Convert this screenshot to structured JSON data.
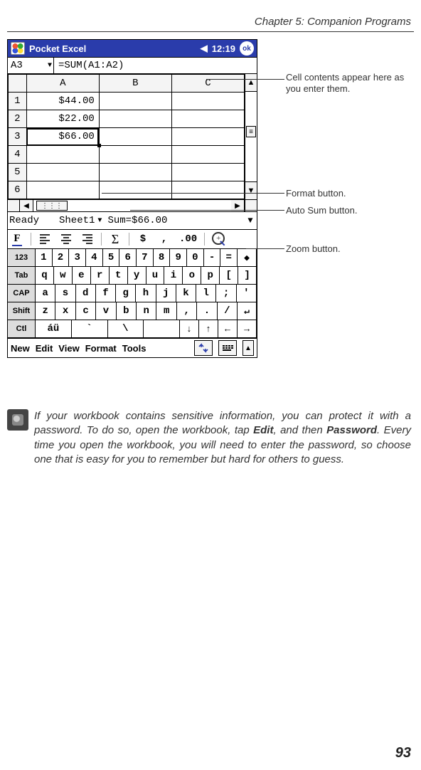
{
  "page": {
    "chapter_header": "Chapter 5: Companion Programs",
    "page_number": "93"
  },
  "callouts": {
    "formula": "Cell contents appear here as you enter them.",
    "format": "Format button.",
    "autosum": "Auto Sum button.",
    "zoom": "Zoom button."
  },
  "titlebar": {
    "app_name": "Pocket Excel",
    "time": "12:19",
    "ok_label": "ok"
  },
  "formula_bar": {
    "cell_ref": "A3",
    "formula": "=SUM(A1:A2)"
  },
  "columns": [
    "A",
    "B",
    "C"
  ],
  "rows": [
    {
      "num": "1",
      "A": "$44.00",
      "B": "",
      "C": "",
      "selected": false
    },
    {
      "num": "2",
      "A": "$22.00",
      "B": "",
      "C": "",
      "selected": false
    },
    {
      "num": "3",
      "A": "$66.00",
      "B": "",
      "C": "",
      "selected": true
    },
    {
      "num": "4",
      "A": "",
      "B": "",
      "C": "",
      "selected": false
    },
    {
      "num": "5",
      "A": "",
      "B": "",
      "C": "",
      "selected": false
    },
    {
      "num": "6",
      "A": "",
      "B": "",
      "C": "",
      "selected": false
    }
  ],
  "statusbar": {
    "ready": "Ready",
    "sheet": "Sheet1",
    "sum": "Sum=$66.00"
  },
  "toolbar": {
    "format_label": "F",
    "sigma": "Σ",
    "currency": "$",
    "thousands": ",",
    "decimals": ".00",
    "zoom_plus": "+"
  },
  "sip": {
    "row1": [
      "123",
      "1",
      "2",
      "3",
      "4",
      "5",
      "6",
      "7",
      "8",
      "9",
      "0",
      "-",
      "=",
      "◆"
    ],
    "row2": [
      "Tab",
      "q",
      "w",
      "e",
      "r",
      "t",
      "y",
      "u",
      "i",
      "o",
      "p",
      "[",
      "]"
    ],
    "row3": [
      "CAP",
      "a",
      "s",
      "d",
      "f",
      "g",
      "h",
      "j",
      "k",
      "l",
      ";",
      "'"
    ],
    "row4": [
      "Shift",
      "z",
      "x",
      "c",
      "v",
      "b",
      "n",
      "m",
      ",",
      ".",
      "/",
      "↵"
    ],
    "row5": [
      "Ctl",
      "áü",
      "`",
      "\\",
      " ",
      "↓",
      "↑",
      "←",
      "→"
    ]
  },
  "menubar": {
    "items": [
      "New",
      "Edit",
      "View",
      "Format",
      "Tools"
    ]
  },
  "tip": {
    "text_before": "If your workbook contains sensitive information, you can protect it with a password. To do so, open the workbook, tap ",
    "bold1": "Edit",
    "text_mid": ", and then ",
    "bold2": "Password",
    "text_after": ". Every time you open the workbook, you will need to enter the password, so choose one that is easy for you to remember but hard for others to guess."
  }
}
